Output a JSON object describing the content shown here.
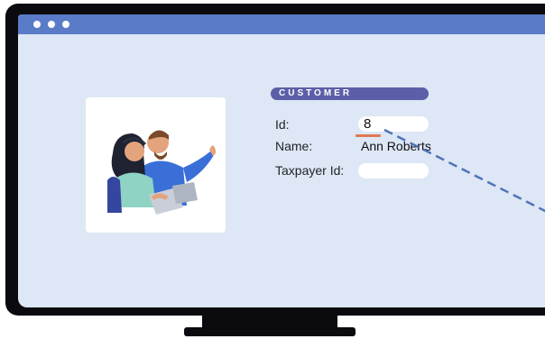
{
  "window": {
    "controls": [
      "dot-icon",
      "dot-icon",
      "dot-icon"
    ]
  },
  "illustration": {
    "subject": "two-people-reading-icon"
  },
  "customer": {
    "section_title": "CUSTOMER",
    "id_label": "Id:",
    "id_value": "8",
    "name_label": "Name:",
    "name_value": "Ann Roberts",
    "taxpayer_label": "Taxpayer Id:",
    "taxpayer_value": ""
  },
  "colors": {
    "screen_bg": "#dde7f5",
    "titlebar": "#5a7cc8",
    "section_pill": "#5c5fa8",
    "highlight": "#e07a4f",
    "connector": "#4f74b8",
    "frame": "#0b0b0f"
  }
}
